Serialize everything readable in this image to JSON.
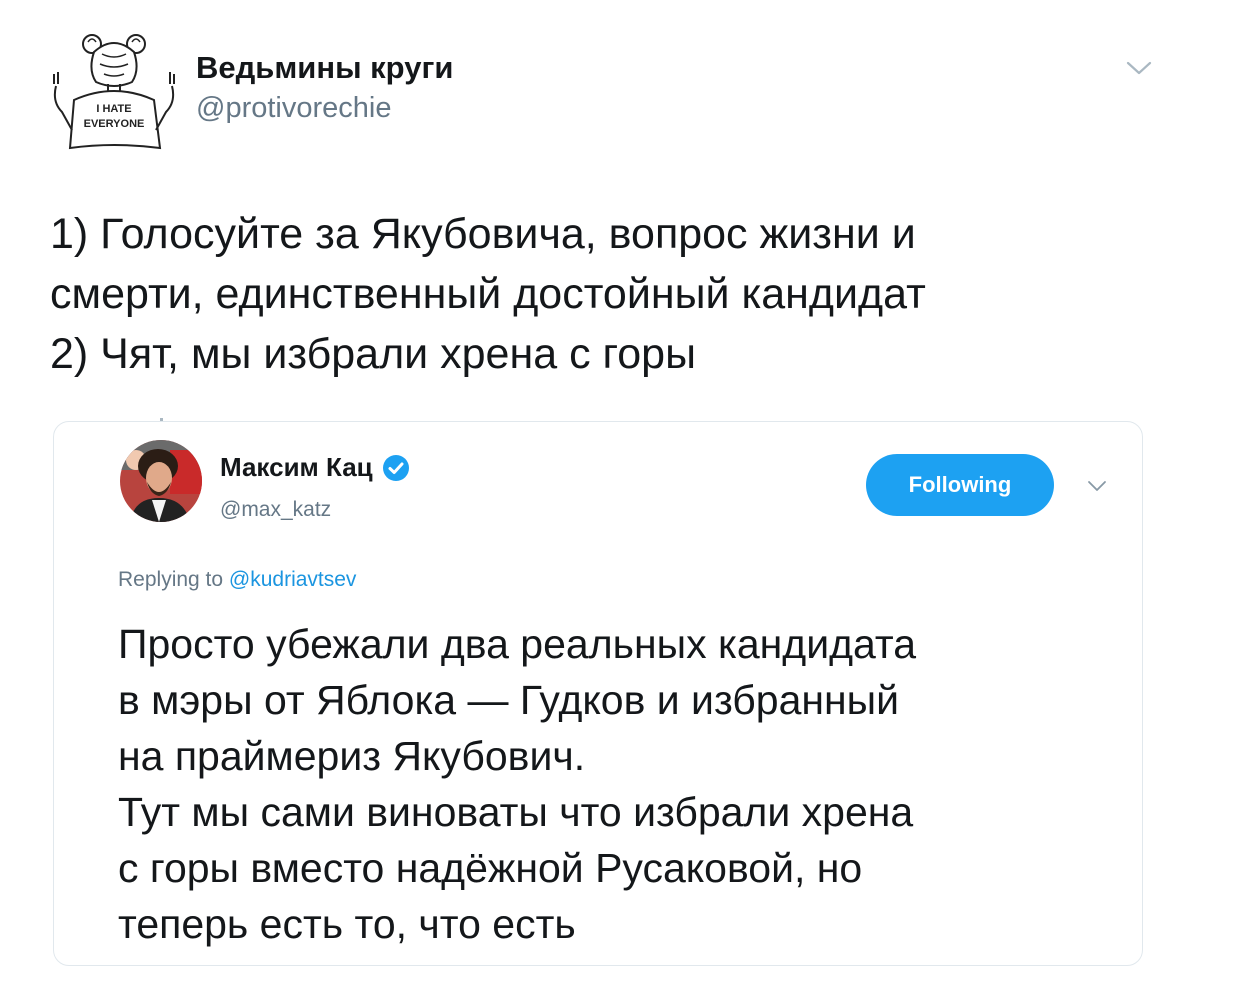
{
  "tweet": {
    "author": {
      "display_name": "Ведьмины круги",
      "handle": "@protivorechie",
      "avatar_caption": "I HATE EVERYONE",
      "avatar_icon": "girl-with-buns-avatar-icon"
    },
    "menu_icon": "chevron-down-icon",
    "text_lines": [
      "1) Голосуйте за Якубовича, вопрос жизни и",
      "смерти, единственный достойный кандидат",
      "2) Чят, мы избрали хрена с горы"
    ],
    "colors": {
      "text": "#14171a",
      "secondary": "#657786",
      "border": "#e1e8ed"
    }
  },
  "quoted_tweet": {
    "author": {
      "display_name": "Максим Кац",
      "handle": "@max_katz",
      "verified": true,
      "verified_icon": "verified-badge-icon"
    },
    "follow_button_label": "Following",
    "menu_icon": "chevron-down-icon",
    "replying_prefix": "Replying to",
    "replying_to": "@kudriavtsev",
    "text_lines": [
      "Просто убежали два реальных кандидата",
      "в мэры от Яблока — Гудков и избранный",
      "на праймериз Якубович.",
      "Тут мы сами виноваты что избрали хрена",
      "с горы вместо надёжной Русаковой, но",
      "теперь есть то, что есть"
    ],
    "colors": {
      "accent": "#1da1f2",
      "link": "#1b95e0"
    }
  }
}
